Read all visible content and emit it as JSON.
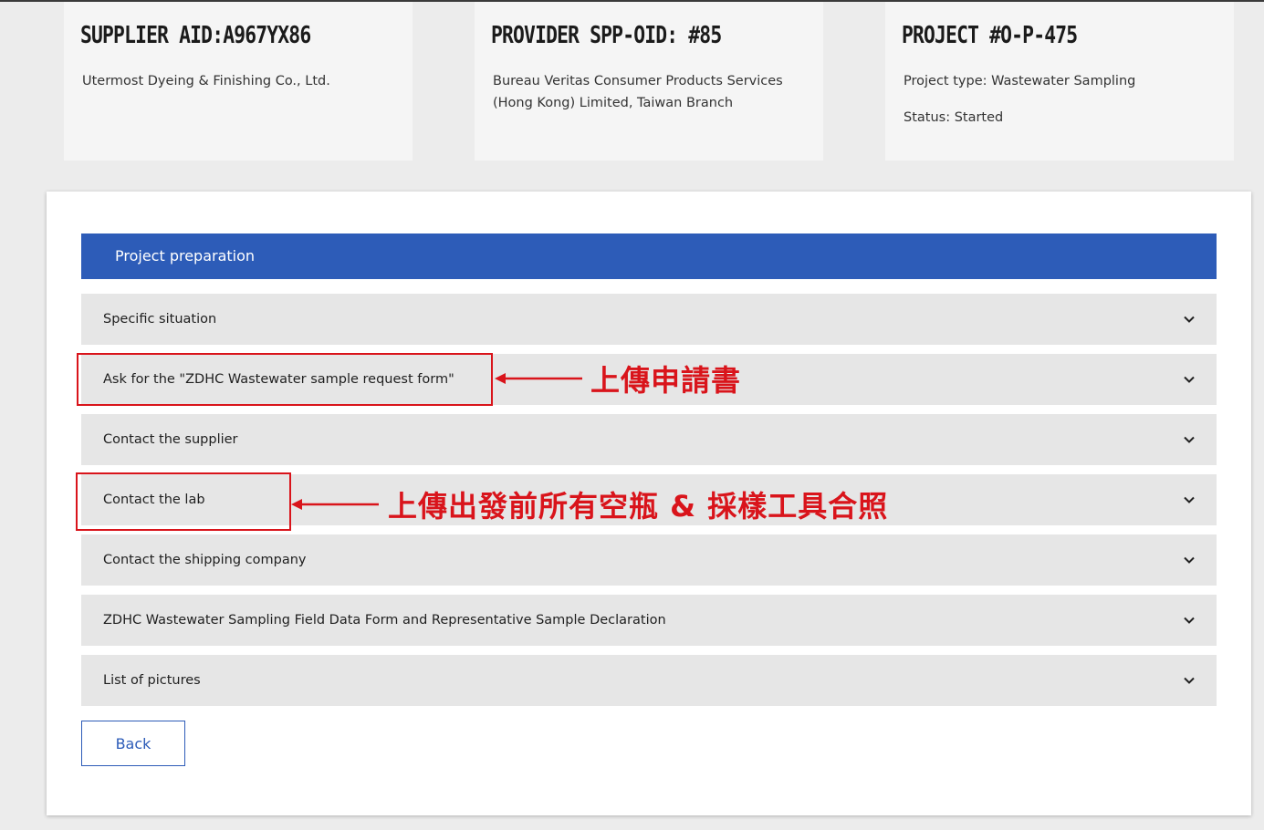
{
  "cards": [
    {
      "title": "SUPPLIER AID:A967YX86",
      "lines": [
        "Utermost Dyeing & Finishing Co., Ltd."
      ]
    },
    {
      "title": "PROVIDER SPP-OID: #85",
      "lines": [
        "Bureau Veritas Consumer Products Services (Hong Kong) Limited, Taiwan Branch"
      ]
    },
    {
      "title": "PROJECT #O-P-475",
      "lines": [
        "Project type: Wastewater Sampling",
        "Status: Started"
      ]
    }
  ],
  "section": {
    "title": "Project preparation"
  },
  "accordion": [
    {
      "label": "Specific situation"
    },
    {
      "label": "Ask for the \"ZDHC Wastewater sample request form\""
    },
    {
      "label": "Contact the supplier"
    },
    {
      "label": "Contact the lab"
    },
    {
      "label": "Contact the shipping company"
    },
    {
      "label": "ZDHC Wastewater Sampling Field Data Form and Representative Sample Declaration"
    },
    {
      "label": "List of pictures"
    }
  ],
  "back_button": {
    "label": "Back"
  },
  "annotations": [
    {
      "text": "上傳申請書"
    },
    {
      "text": "上傳出發前所有空瓶 & 採樣工具合照"
    }
  ],
  "colors": {
    "accent": "#2d5cb8",
    "annotation": "#d9141b",
    "row_bg": "#e6e6e6",
    "card_bg": "#f5f5f5"
  }
}
